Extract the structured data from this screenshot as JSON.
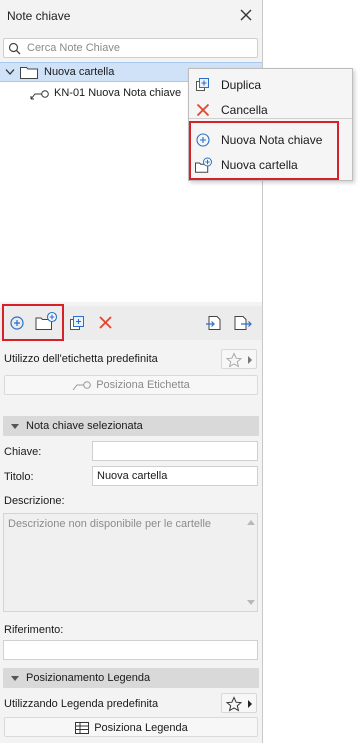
{
  "panel": {
    "title": "Note chiave",
    "search_placeholder": "Cerca Note Chiave"
  },
  "tree": {
    "folder_label": "Nuova cartella",
    "note_label": "KN-01 Nuova Nota chiave"
  },
  "context_menu": {
    "items": [
      {
        "label": "Duplica",
        "icon": "duplicate-icon"
      },
      {
        "label": "Cancella",
        "icon": "delete-x-icon"
      },
      {
        "label": "Nuova Nota chiave",
        "icon": "add-circle-icon"
      },
      {
        "label": "Nuova cartella",
        "icon": "new-folder-icon"
      }
    ]
  },
  "label_section": {
    "usage_label": "Utilizzo dell'etichetta predefinita",
    "place_button": "Posiziona Etichetta"
  },
  "selected_section": {
    "header": "Nota chiave selezionata",
    "key_label": "Chiave:",
    "key_value": "",
    "title_label": "Titolo:",
    "title_value": "Nuova cartella",
    "desc_label": "Descrizione:",
    "desc_placeholder": "Descrizione non disponibile per le cartelle",
    "ref_label": "Riferimento:",
    "ref_value": ""
  },
  "legend_section": {
    "header": "Posizionamento Legenda",
    "usage_label": "Utilizzando Legenda predefinita",
    "place_button": "Posiziona Legenda"
  },
  "colors": {
    "accent_blue": "#2a6fc9",
    "delete_red": "#e2452f",
    "highlight_red": "#d7202a",
    "selection_bg": "#cfe2f7"
  }
}
